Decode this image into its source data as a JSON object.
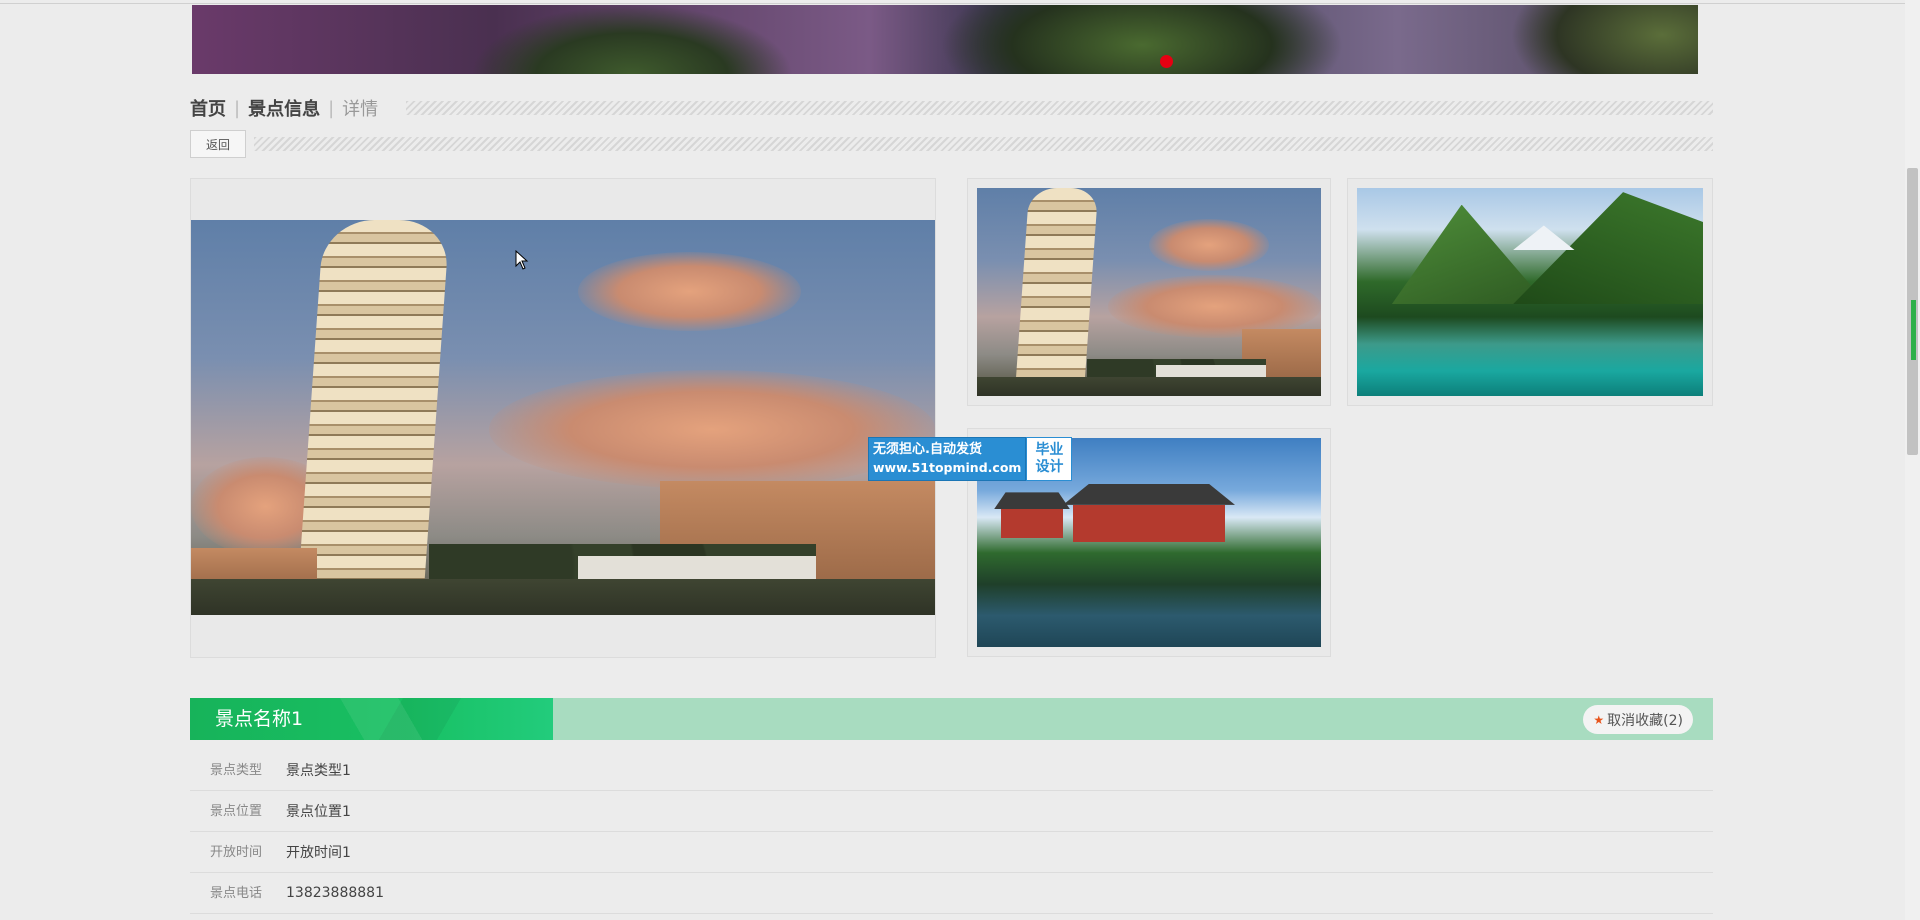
{
  "breadcrumb": {
    "home": "首页",
    "section": "景点信息",
    "current": "详情"
  },
  "actions": {
    "back_label": "返回"
  },
  "watermark": {
    "line1": "无须担心.自动发货",
    "url": "www.51topmind.com",
    "tag": "毕业设计"
  },
  "detail": {
    "title": "景点名称1",
    "favorite_label": "取消收藏(2)",
    "fields": [
      {
        "label": "景点类型",
        "value": "景点类型1"
      },
      {
        "label": "景点位置",
        "value": "景点位置1"
      },
      {
        "label": "开放时间",
        "value": "开放时间1"
      },
      {
        "label": "景点电话",
        "value": "13823888881"
      }
    ]
  },
  "colors": {
    "accent_green": "#17b35a",
    "title_bar_bg": "#a8dcc0",
    "carousel_dot": "#e60012",
    "star": "#e8541c"
  },
  "icons": {
    "favorite": "star-icon",
    "cursor": "mouse-pointer-icon"
  }
}
